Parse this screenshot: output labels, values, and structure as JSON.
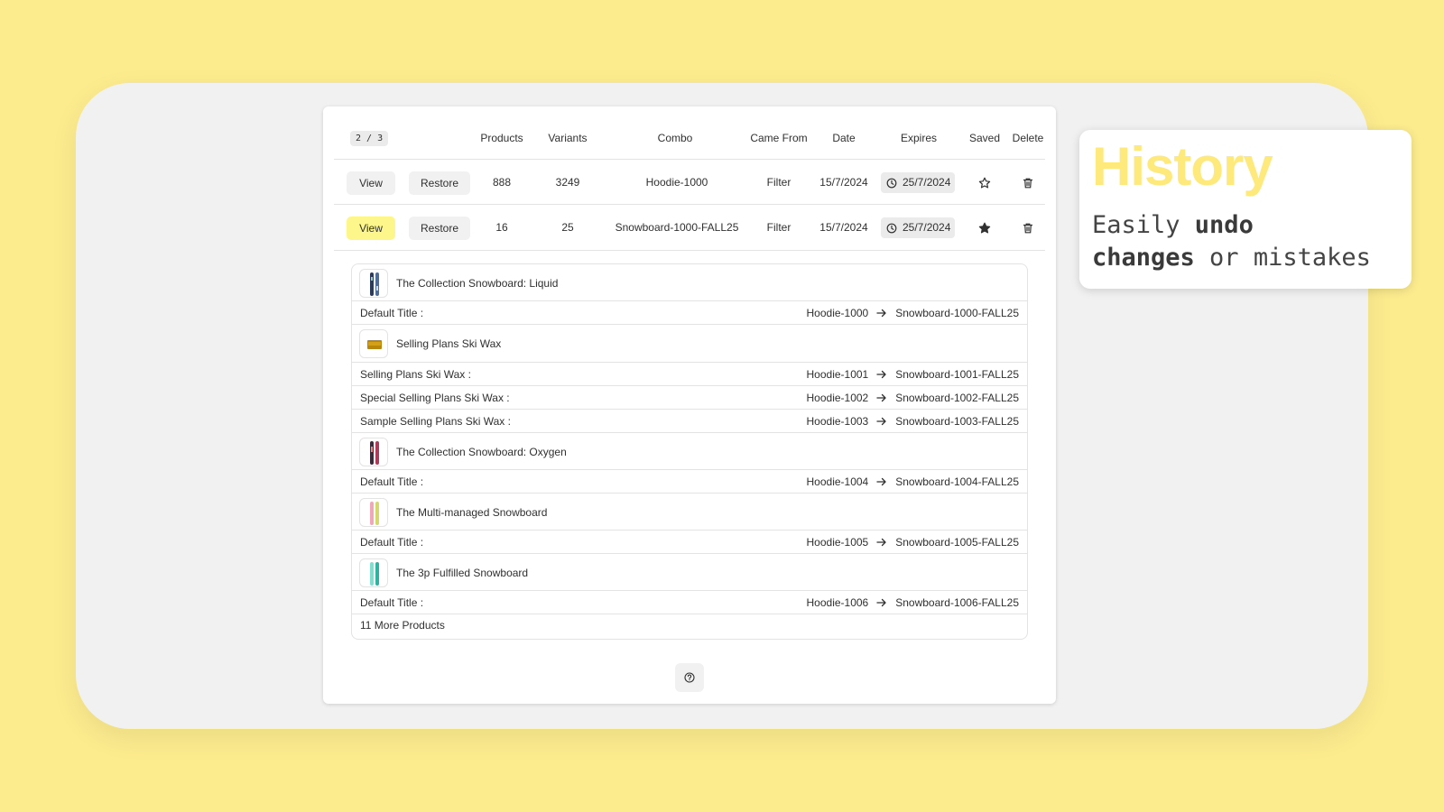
{
  "callout": {
    "title": "History",
    "line_part1": "Easily ",
    "line_bold1": "undo",
    "line_bold2": "changes",
    "line_part2": " or mistakes"
  },
  "header": {
    "pager": "2 / 3",
    "columns": [
      "Products",
      "Variants",
      "Combo",
      "Came From",
      "Date",
      "Expires",
      "Saved",
      "Delete"
    ]
  },
  "rows": [
    {
      "view_label": "View",
      "restore_label": "Restore",
      "products": "888",
      "variants": "3249",
      "combo": "Hoodie-1000",
      "came_from": "Filter",
      "date": "15/7/2024",
      "expires": "25/7/2024",
      "saved": false,
      "selected": false
    },
    {
      "view_label": "View",
      "restore_label": "Restore",
      "products": "16",
      "variants": "25",
      "combo": "Snowboard-1000-FALL25",
      "came_from": "Filter",
      "date": "15/7/2024",
      "expires": "25/7/2024",
      "saved": true,
      "selected": true
    }
  ],
  "detail": {
    "products": [
      {
        "name": "The Collection Snowboard: Liquid",
        "thumb": "snowboard-liquid",
        "variants": [
          {
            "label": "Default Title :",
            "from": "Hoodie-1000",
            "to": "Snowboard-1000-FALL25"
          }
        ]
      },
      {
        "name": "Selling Plans Ski Wax",
        "thumb": "ski-wax",
        "variants": [
          {
            "label": "Selling Plans Ski Wax :",
            "from": "Hoodie-1001",
            "to": "Snowboard-1001-FALL25"
          },
          {
            "label": "Special Selling Plans Ski Wax :",
            "from": "Hoodie-1002",
            "to": "Snowboard-1002-FALL25"
          },
          {
            "label": "Sample Selling Plans Ski Wax :",
            "from": "Hoodie-1003",
            "to": "Snowboard-1003-FALL25"
          }
        ]
      },
      {
        "name": "The Collection Snowboard: Oxygen",
        "thumb": "snowboard-oxygen",
        "variants": [
          {
            "label": "Default Title :",
            "from": "Hoodie-1004",
            "to": "Snowboard-1004-FALL25"
          }
        ]
      },
      {
        "name": "The Multi-managed Snowboard",
        "thumb": "snowboard-multi",
        "variants": [
          {
            "label": "Default Title :",
            "from": "Hoodie-1005",
            "to": "Snowboard-1005-FALL25"
          }
        ]
      },
      {
        "name": "The 3p Fulfilled Snowboard",
        "thumb": "snowboard-3p",
        "variants": [
          {
            "label": "Default Title :",
            "from": "Hoodie-1006",
            "to": "Snowboard-1006-FALL25"
          }
        ]
      }
    ],
    "more_label": "11 More Products"
  },
  "icons": {
    "clock": "clock-icon",
    "star_outline": "star-outline-icon",
    "star_filled": "star-filled-icon",
    "trash": "trash-icon",
    "arrow": "arrow-right-icon",
    "help": "question-circle-icon"
  },
  "colors": {
    "background": "#fdec8e",
    "title_yellow": "#fde97c",
    "active_button": "#fdf68a"
  }
}
